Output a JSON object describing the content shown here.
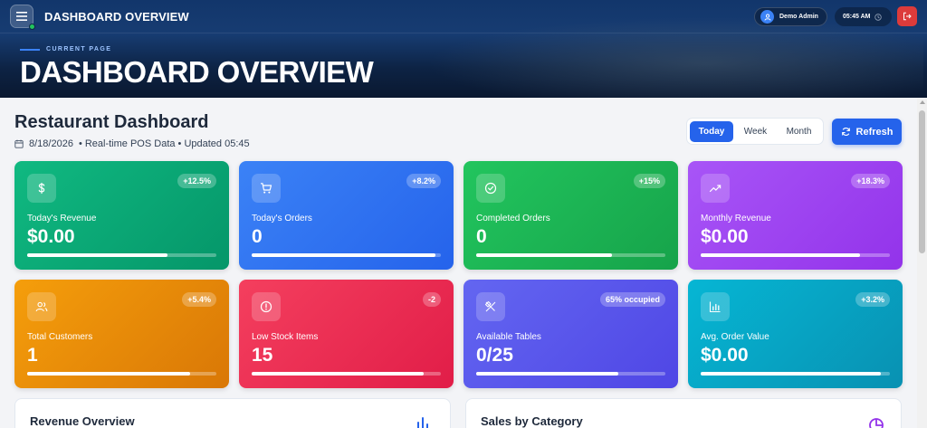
{
  "topbar": {
    "title": "DASHBOARD OVERVIEW",
    "user_name": "Demo Admin",
    "time": "05:45 AM"
  },
  "hero": {
    "subtitle": "CURRENT PAGE",
    "title": "DASHBOARD OVERVIEW"
  },
  "dashboard": {
    "title": "Restaurant Dashboard",
    "date": "8/18/2026",
    "meta_rest": "• Real-time POS Data • Updated 05:45",
    "ranges": [
      "Today",
      "Week",
      "Month"
    ],
    "active_range": "Today",
    "refresh_label": "Refresh"
  },
  "cards": [
    {
      "label": "Today's Revenue",
      "value": "$0.00",
      "badge": "+12.5%",
      "progress": 0.74,
      "icon": "dollar-icon",
      "color_start": "#10b981",
      "color_end": "#059669"
    },
    {
      "label": "Today's Orders",
      "value": "0",
      "badge": "+8.2%",
      "progress": 0.97,
      "icon": "cart-icon",
      "color_start": "#3b82f6",
      "color_end": "#2563eb"
    },
    {
      "label": "Completed Orders",
      "value": "0",
      "badge": "+15%",
      "progress": 0.72,
      "icon": "check-circle-icon",
      "color_start": "#22c55e",
      "color_end": "#16a34a"
    },
    {
      "label": "Monthly Revenue",
      "value": "$0.00",
      "badge": "+18.3%",
      "progress": 0.84,
      "icon": "trending-up-icon",
      "color_start": "#a855f7",
      "color_end": "#9333ea"
    },
    {
      "label": "Total Customers",
      "value": "1",
      "badge": "+5.4%",
      "progress": 0.86,
      "icon": "users-icon",
      "color_start": "#f59e0b",
      "color_end": "#d97706"
    },
    {
      "label": "Low Stock Items",
      "value": "15",
      "badge": "-2",
      "progress": 0.91,
      "icon": "alert-circle-icon",
      "color_start": "#f43f5e",
      "color_end": "#e11d48"
    },
    {
      "label": "Available Tables",
      "value": "0/25",
      "badge": "65% occupied",
      "progress": 0.75,
      "icon": "utensils-icon",
      "color_start": "#6366f1",
      "color_end": "#4f46e5"
    },
    {
      "label": "Avg. Order Value",
      "value": "$0.00",
      "badge": "+3.2%",
      "progress": 0.95,
      "icon": "bar-chart-icon",
      "color_start": "#06b6d4",
      "color_end": "#0891b2"
    }
  ],
  "panels": {
    "revenue_title": "Revenue Overview",
    "sales_title": "Sales by Category"
  }
}
